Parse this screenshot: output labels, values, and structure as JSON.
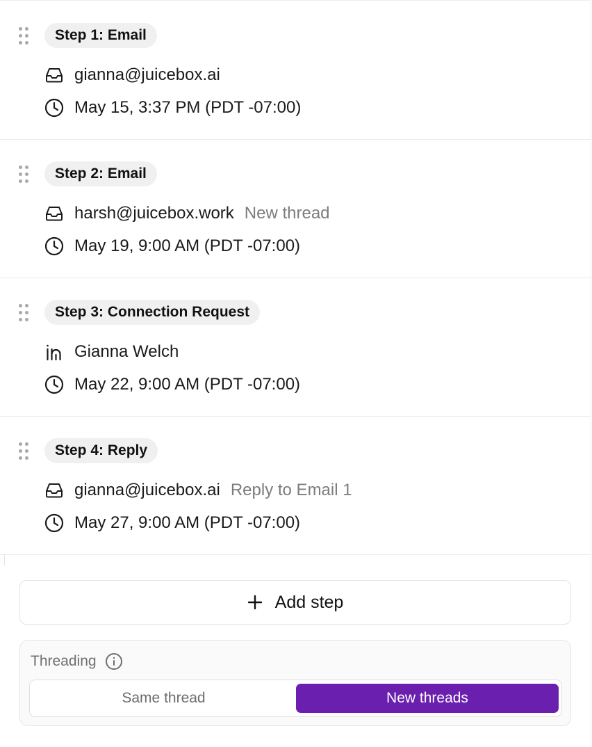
{
  "steps": [
    {
      "label": "Step 1: Email",
      "channel_icon": "inbox-icon",
      "account": "gianna@juicebox.ai",
      "note": "",
      "schedule": "May 15, 3:37 PM (PDT -07:00)"
    },
    {
      "label": "Step 2: Email",
      "channel_icon": "inbox-icon",
      "account": "harsh@juicebox.work",
      "note": "New thread",
      "schedule": "May 19, 9:00 AM (PDT -07:00)"
    },
    {
      "label": "Step 3: Connection Request",
      "channel_icon": "linkedin-icon",
      "account": "Gianna Welch",
      "note": "",
      "schedule": "May 22, 9:00 AM (PDT -07:00)"
    },
    {
      "label": "Step 4: Reply",
      "channel_icon": "inbox-icon",
      "account": "gianna@juicebox.ai",
      "note": "Reply to Email 1",
      "schedule": "May 27, 9:00 AM (PDT -07:00)"
    }
  ],
  "add_step": {
    "label": "Add step",
    "icon": "plus-icon"
  },
  "threading": {
    "title": "Threading",
    "info_icon": "info-icon",
    "options": [
      "Same thread",
      "New threads"
    ],
    "selected": "New threads",
    "accent_color": "#6b1fae"
  }
}
